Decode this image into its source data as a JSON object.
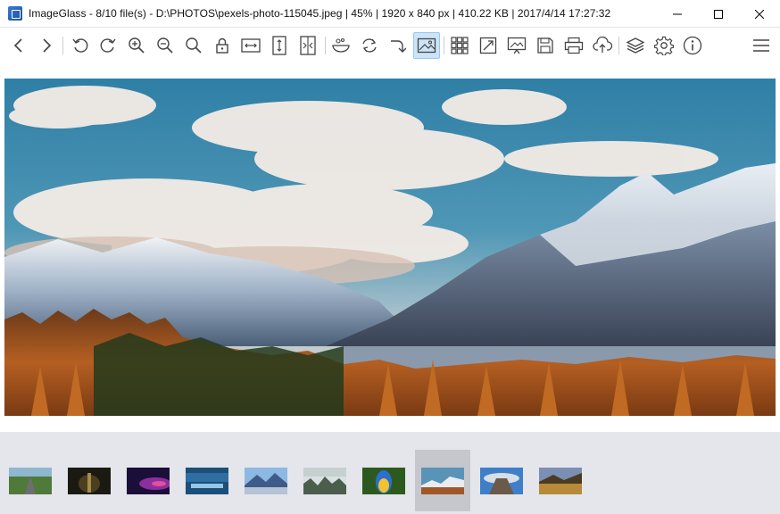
{
  "window": {
    "title": "ImageGlass - 8/10 file(s) - D:\\PHOTOS\\pexels-photo-115045.jpeg  |  45%  |  1920 x 840 px  |  410.22 KB  |  2017/4/14 17:27:32",
    "app_icon": "imageglass-app-icon",
    "controls": [
      "minimize-icon",
      "maximize-icon",
      "close-icon"
    ]
  },
  "toolbar": {
    "buttons": [
      {
        "icon": "back-arrow-icon",
        "active": false
      },
      {
        "icon": "forward-arrow-icon",
        "active": false
      },
      {
        "icon": "rotate-left-icon",
        "active": false
      },
      {
        "icon": "rotate-right-icon",
        "active": false
      },
      {
        "icon": "zoom-in-icon",
        "active": false
      },
      {
        "icon": "zoom-out-icon",
        "active": false
      },
      {
        "icon": "actual-size-icon",
        "active": false
      },
      {
        "icon": "lock-zoom-icon",
        "active": false
      },
      {
        "icon": "fit-width-icon",
        "active": false
      },
      {
        "icon": "fit-height-icon",
        "active": false
      },
      {
        "icon": "scale-to-fit-icon",
        "active": false
      },
      {
        "icon": "soap-icon",
        "active": false
      },
      {
        "icon": "refresh-icon",
        "active": false
      },
      {
        "icon": "goto-icon",
        "active": false
      },
      {
        "icon": "checkered-background-icon",
        "active": true
      },
      {
        "icon": "thumbnails-icon",
        "active": false
      },
      {
        "icon": "fullscreen-icon",
        "active": false
      },
      {
        "icon": "slideshow-icon",
        "active": false
      },
      {
        "icon": "save-icon",
        "active": false
      },
      {
        "icon": "print-icon",
        "active": false
      },
      {
        "icon": "upload-icon",
        "active": false
      },
      {
        "icon": "extensions-icon",
        "active": false
      },
      {
        "icon": "settings-icon",
        "active": false
      },
      {
        "icon": "about-icon",
        "active": false
      },
      {
        "icon": "menu-icon",
        "active": false
      }
    ]
  },
  "viewer": {
    "image": "mountain-landscape-photo",
    "zoom": "45%",
    "image_size": "1920 x 840 px"
  },
  "thumbnails": {
    "count": 10,
    "selected_index": 7,
    "items": [
      {
        "subject": "road-forest",
        "colors": [
          "#8fb7cf",
          "#4f7a3a",
          "#6e6e6e"
        ]
      },
      {
        "subject": "night-waterfall",
        "colors": [
          "#1a1a12",
          "#4b3f1f",
          "#a58a4a"
        ]
      },
      {
        "subject": "purple-sky",
        "colors": [
          "#1b0f3a",
          "#8a2f9c",
          "#e24ea0"
        ]
      },
      {
        "subject": "blue-lake",
        "colors": [
          "#2f6ea2",
          "#1b4f7a",
          "#94c6e6"
        ]
      },
      {
        "subject": "mountain-lake",
        "colors": [
          "#8db8e2",
          "#3e5c8a",
          "#e9eef5"
        ]
      },
      {
        "subject": "misty-forest",
        "colors": [
          "#d9e0e2",
          "#4b5e4c",
          "#a9b8b3"
        ]
      },
      {
        "subject": "parrot",
        "colors": [
          "#2c5a1e",
          "#2a6fd1",
          "#f2c230"
        ]
      },
      {
        "subject": "mountains-autumn",
        "colors": [
          "#5a93b8",
          "#e8ecef",
          "#a0582a"
        ]
      },
      {
        "subject": "rock-formation",
        "colors": [
          "#3f7fc7",
          "#d6dfe6",
          "#6b5a4a"
        ]
      },
      {
        "subject": "sunset-field",
        "colors": [
          "#7a8fb3",
          "#b88a3a",
          "#4a3b22"
        ]
      }
    ]
  },
  "colors": {
    "titlebar_bg": "#ffffff",
    "toolbar_active": "#cce4f7",
    "thumbbar_bg": "#e4e6eb",
    "thumb_selected": "#c5c7cc",
    "icon_stroke": "#444444"
  }
}
